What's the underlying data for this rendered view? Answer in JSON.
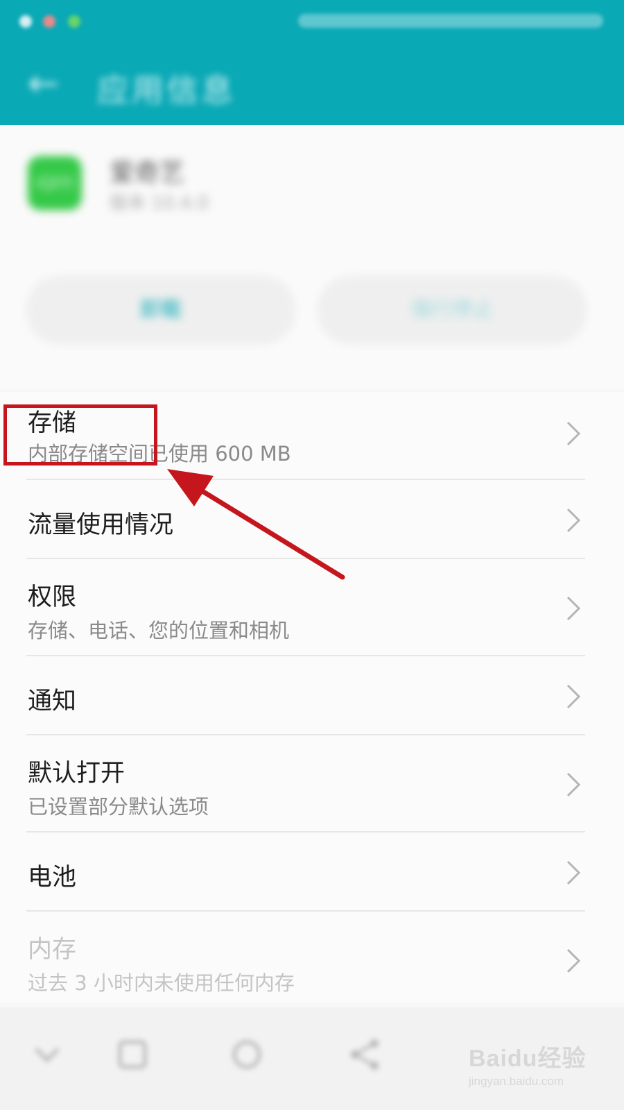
{
  "header": {
    "title": "应用信息",
    "back_icon": "back-arrow-icon",
    "background_color": "#0aa9b6"
  },
  "app": {
    "name": "爱奇艺",
    "version": "版本 10.4.0",
    "icon": "app-icon",
    "icon_color": "#35c948",
    "buttons": {
      "uninstall": "卸载",
      "force_stop": "强行停止"
    }
  },
  "settings": {
    "items": [
      {
        "title": "存储",
        "subtitle": "内部存储空间已使用 600 MB"
      },
      {
        "title": "流量使用情况",
        "subtitle": ""
      },
      {
        "title": "权限",
        "subtitle": "存储、电话、您的位置和相机"
      },
      {
        "title": "通知",
        "subtitle": ""
      },
      {
        "title": "默认打开",
        "subtitle": "已设置部分默认选项"
      },
      {
        "title": "电池",
        "subtitle": ""
      },
      {
        "title": "内存",
        "subtitle": "过去 3 小时内未使用任何内存"
      }
    ]
  },
  "annotation": {
    "highlight_color": "#c4161c",
    "arrow_icon": "red-arrow-icon"
  },
  "navbar": {
    "icons": [
      "chevron-down-icon",
      "square-icon",
      "circle-icon",
      "share-icon"
    ]
  },
  "watermark": {
    "logo": "Baidu经验",
    "url": "jingyan.baidu.com"
  }
}
